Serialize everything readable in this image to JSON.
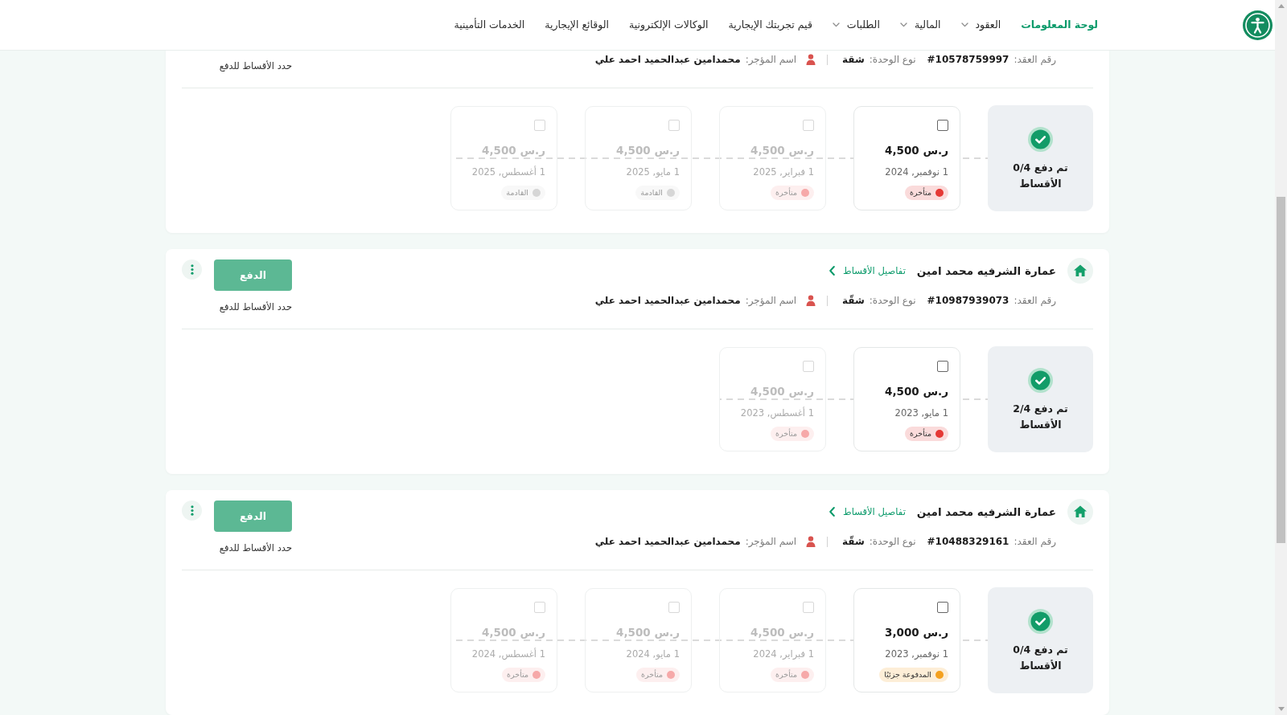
{
  "nav": {
    "items": [
      {
        "label": "لوحة المعلومات",
        "selected": true,
        "dropdown": false
      },
      {
        "label": "العقود",
        "selected": false,
        "dropdown": true
      },
      {
        "label": "المالية",
        "selected": false,
        "dropdown": true
      },
      {
        "label": "الطلبات",
        "selected": false,
        "dropdown": true
      },
      {
        "label": "قيم تجربتك الإيجارية",
        "selected": false,
        "dropdown": false
      },
      {
        "label": "الوكالات الإلكترونية",
        "selected": false,
        "dropdown": false
      },
      {
        "label": "الوقائع الإيجارية",
        "selected": false,
        "dropdown": false
      },
      {
        "label": "الخدمات التأمينية",
        "selected": false,
        "dropdown": false
      }
    ]
  },
  "contracts": [
    {
      "more_menu": false,
      "contract_label": "رقم العقد:",
      "contract_number": "#10578759997",
      "unit_label": "نوع الوحدة:",
      "unit_type": "شقة",
      "landlord_label": "اسم المؤجر:",
      "landlord_name": "محمدامين عبدالحميد احمد علي",
      "select_hint": "حدد الأقساط للدفع",
      "summary": "تم دفع 0/4 الأقساط",
      "installments": [
        {
          "amount": "ر.س 4,500",
          "date": "1 نوفمبر, 2024",
          "status": {
            "label": "متأخرة",
            "color": "#e53935"
          },
          "checked": false,
          "disabled": false
        },
        {
          "amount": "ر.س 4,500",
          "date": "1 فبراير, 2025",
          "status": {
            "label": "متأخرة",
            "color": "#f6a9a9"
          },
          "checked": false,
          "disabled": true
        },
        {
          "amount": "ر.س 4,500",
          "date": "1 مايو, 2025",
          "status": {
            "label": "القادمة",
            "color": "#d6d6d6"
          },
          "checked": false,
          "disabled": true
        },
        {
          "amount": "ر.س 4,500",
          "date": "1 أغسطس, 2025",
          "status": {
            "label": "القادمة",
            "color": "#d6d6d6"
          },
          "checked": false,
          "disabled": true
        }
      ]
    },
    {
      "title": "عمارة الشرفيه محمد امين",
      "details_link": "تفاصيل الأقساط",
      "more_menu": true,
      "pay_button": "الدفع",
      "contract_label": "رقم العقد:",
      "contract_number": "#10987939073",
      "unit_label": "نوع الوحدة:",
      "unit_type": "شقّة",
      "landlord_label": "اسم المؤجر:",
      "landlord_name": "محمدامين عبدالحميد احمد علي",
      "select_hint": "حدد الأقساط للدفع",
      "summary": "تم دفع 2/4 الأقساط",
      "installments": [
        {
          "amount": "ر.س 4,500",
          "date": "1 مايو, 2023",
          "status": {
            "label": "متأخرة",
            "color": "#e53935"
          },
          "checked": false,
          "disabled": false
        },
        {
          "amount": "ر.س 4,500",
          "date": "1 أغسطس, 2023",
          "status": {
            "label": "متأخرة",
            "color": "#f6a9a9"
          },
          "checked": false,
          "disabled": true
        }
      ]
    },
    {
      "title": "عمارة الشرفيه محمد امين",
      "details_link": "تفاصيل الأقساط",
      "more_menu": true,
      "pay_button": "الدفع",
      "contract_label": "رقم العقد:",
      "contract_number": "#10488329161",
      "unit_label": "نوع الوحدة:",
      "unit_type": "شقّة",
      "landlord_label": "اسم المؤجر:",
      "landlord_name": "محمدامين عبدالحميد احمد علي",
      "select_hint": "حدد الأقساط للدفع",
      "summary": "تم دفع 0/4 الأقساط",
      "installments": [
        {
          "amount": "ر.س 3,000",
          "date": "1 نوفمبر, 2023",
          "status": {
            "label": "المدفوعة جزئيًا",
            "color": "#f4a11f"
          },
          "checked": false,
          "disabled": false
        },
        {
          "amount": "ر.س 4,500",
          "date": "1 فبراير, 2024",
          "status": {
            "label": "متأخرة",
            "color": "#f6a9a9"
          },
          "checked": false,
          "disabled": true
        },
        {
          "amount": "ر.س 4,500",
          "date": "1 مايو, 2024",
          "status": {
            "label": "متأخرة",
            "color": "#f6a9a9"
          },
          "checked": false,
          "disabled": true
        },
        {
          "amount": "ر.س 4,500",
          "date": "1 أغسطس, 2024",
          "status": {
            "label": "متأخرة",
            "color": "#f6a9a9"
          },
          "checked": false,
          "disabled": true
        }
      ]
    }
  ]
}
